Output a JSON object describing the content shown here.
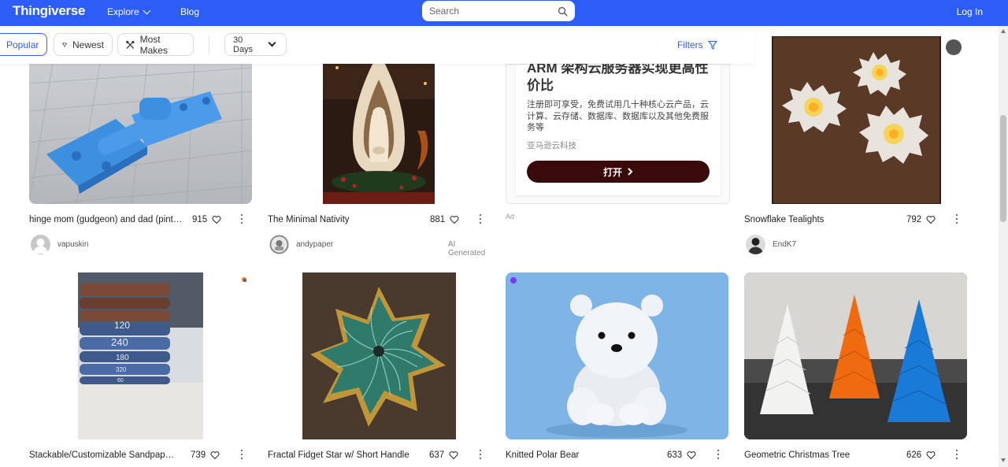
{
  "nav": {
    "logo": "Thingiverse",
    "explore": "Explore",
    "blog": "Blog",
    "search_placeholder": "Search",
    "login": "Log In"
  },
  "filters": {
    "popular": "Popular",
    "newest": "Newest",
    "most_makes": "Most Makes",
    "period": "30 Days",
    "filters_label": "Filters"
  },
  "ad": {
    "headline": "ARM 架构云服务器实现更高性价比",
    "body": "注册即可享受，免费试用几十种核心云产品，云计算、云存储、数据库、数据库以及其他免费服务等",
    "brand": "亚马逊云科技",
    "button": "打开",
    "label": "Ad"
  },
  "cards": [
    {
      "title": "hinge mom (gudgeon) and dad (pintle)",
      "likes": "915",
      "author": "vapuskin",
      "tag": ""
    },
    {
      "title": "The Minimal Nativity",
      "likes": "881",
      "author": "andypaper",
      "tag": "AI Generated"
    },
    {
      "title": "Snowflake Tealights",
      "likes": "792",
      "author": "EndK7",
      "tag": ""
    },
    {
      "title": "Stackable/Customizable Sandpaper...",
      "likes": "739",
      "author": "",
      "tag": ""
    },
    {
      "title": "Fractal Fidget Star w/ Short Handle",
      "likes": "637",
      "author": "",
      "tag": ""
    },
    {
      "title": "Knitted Polar Bear",
      "likes": "633",
      "author": "",
      "tag": ""
    },
    {
      "title": "Geometric Christmas Tree",
      "likes": "626",
      "author": "",
      "tag": ""
    }
  ],
  "sandpaper_labels": [
    "120",
    "240",
    "180",
    "320",
    "60"
  ],
  "colors": {
    "brand": "#2d5cf6",
    "ad_button": "#3a0a0a"
  }
}
